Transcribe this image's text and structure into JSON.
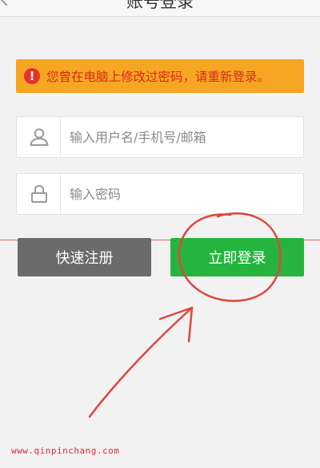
{
  "header": {
    "title": "账号登录"
  },
  "notice": {
    "icon": "alert-icon",
    "text": "您曾在电脑上修改过密码，请重新登录。"
  },
  "form": {
    "username": {
      "icon": "user-icon",
      "placeholder": "输入用户名/手机号/邮箱",
      "value": ""
    },
    "password": {
      "icon": "lock-icon",
      "placeholder": "输入密码",
      "value": ""
    }
  },
  "buttons": {
    "register": "快速注册",
    "login": "立即登录"
  },
  "watermark": "www.qinpinchang.com",
  "colors": {
    "notice_bg": "#f6a623",
    "notice_text": "#d62b1e",
    "login_button": "#25b53f",
    "register_button": "#6b6b6b",
    "annotation": "#e0453c"
  }
}
